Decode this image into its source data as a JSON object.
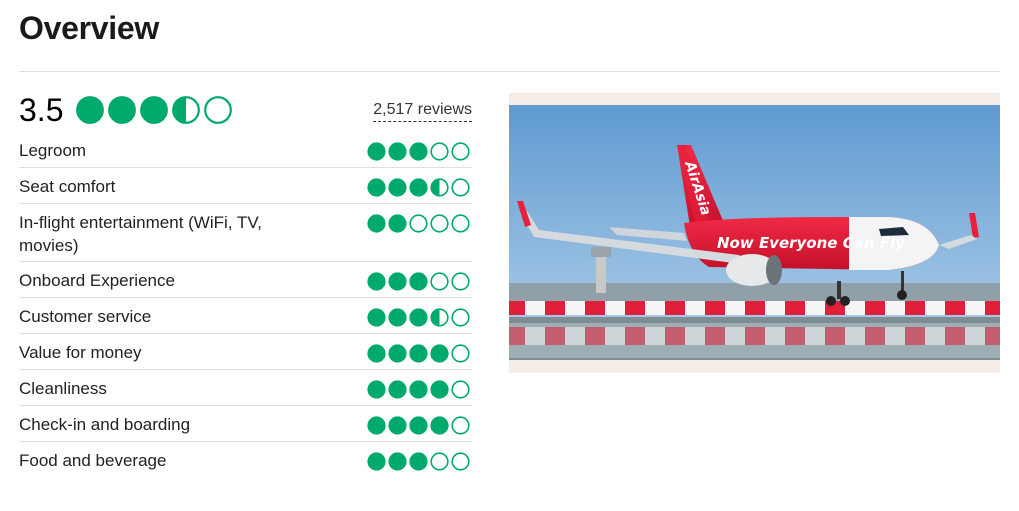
{
  "overview": {
    "title": "Overview"
  },
  "summary": {
    "score": "3.5",
    "rating": 3.5,
    "reviews": "2,517 reviews"
  },
  "colors": {
    "bubble": "#00aa6c",
    "divider": "#e0e0e0"
  },
  "categories": [
    {
      "label": "Legroom",
      "rating": 3
    },
    {
      "label": "Seat comfort",
      "rating": 3.5
    },
    {
      "label": "In-flight entertainment (WiFi, TV, movies)",
      "rating": 2
    },
    {
      "label": "Onboard Experience",
      "rating": 3
    },
    {
      "label": "Customer service",
      "rating": 3.5
    },
    {
      "label": "Value for money",
      "rating": 4
    },
    {
      "label": "Cleanliness",
      "rating": 4
    },
    {
      "label": "Check-in and boarding",
      "rating": 4
    },
    {
      "label": "Food and beverage",
      "rating": 3
    }
  ],
  "photo": {
    "livery_text": "Now Everyone Can Fly",
    "tail_text": "AirAsia"
  }
}
